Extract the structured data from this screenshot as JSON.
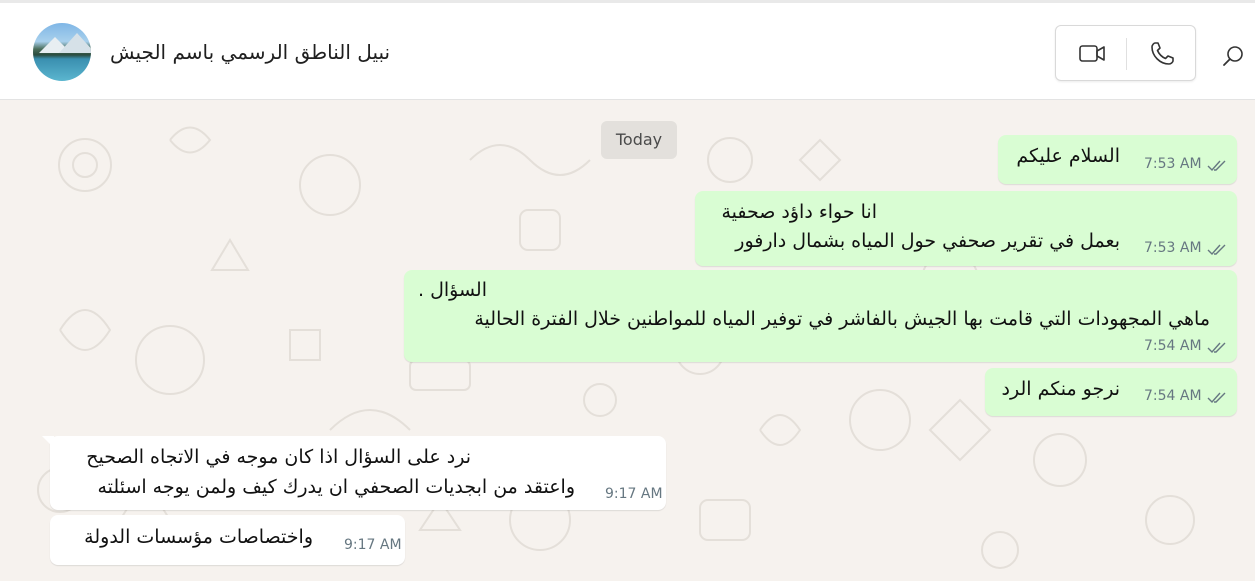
{
  "header": {
    "contact_name": "نبيل الناطق الرسمي باسم الجيش",
    "icons": {
      "video": "video-call-icon",
      "voice": "voice-call-icon",
      "search": "search-icon"
    }
  },
  "chat": {
    "date_divider": "Today",
    "messages": [
      {
        "direction": "outgoing",
        "lines": [
          "السلام عليكم"
        ],
        "time": "7:53 AM",
        "status": "read-ticks"
      },
      {
        "direction": "outgoing",
        "lines": [
          "انا حواء داؤد صحفية",
          "بعمل في تقرير صحفي حول المياه بشمال دارفور"
        ],
        "time": "7:53 AM",
        "status": "read-ticks"
      },
      {
        "direction": "outgoing",
        "lines": [
          "السؤال .",
          "ماهي المجهودات التي قامت بها الجيش  بالفاشر في توفير المياه للمواطنين خلال الفترة الحالية"
        ],
        "time": "7:54 AM",
        "status": "read-ticks"
      },
      {
        "direction": "outgoing",
        "lines": [
          "نرجو منكم الرد"
        ],
        "time": "7:54 AM",
        "status": "read-ticks"
      },
      {
        "direction": "incoming",
        "lines": [
          "نرد على السؤال اذا كان موجه في الاتجاه الصحيح",
          "واعتقد من ابجديات الصحفي ان يدرك كيف ولمن يوجه اسئلته"
        ],
        "time": "9:17 AM"
      },
      {
        "direction": "incoming",
        "lines": [
          "واختصاصات مؤسسات الدولة"
        ],
        "time": "9:17 AM"
      }
    ]
  },
  "colors": {
    "outgoing_bubble": "#d9fdd3",
    "incoming_bubble": "#ffffff",
    "chat_background": "#f6f2ee",
    "read_tick": "#667781"
  }
}
